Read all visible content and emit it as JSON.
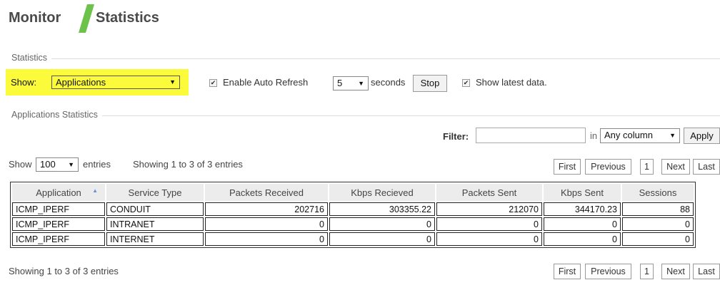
{
  "header": {
    "section": "Monitor",
    "page": "Statistics",
    "slash_color": "#6cc24a"
  },
  "stats_panel": {
    "legend": "Statistics",
    "show_label": "Show:",
    "show_value": "Applications",
    "auto_refresh_label": "Enable Auto Refresh",
    "auto_refresh_checked": true,
    "interval_value": "5",
    "seconds_label": "seconds",
    "stop_label": "Stop",
    "latest_label": "Show latest data.",
    "latest_checked": true
  },
  "app_panel": {
    "legend": "Applications Statistics",
    "filter_label": "Filter:",
    "filter_value": "",
    "in_label": "in",
    "column_value": "Any column",
    "apply_label": "Apply",
    "show_label": "Show",
    "entries_value": "100",
    "entries_label": "entries",
    "info_top": "Showing 1 to 3 of 3 entries",
    "info_bottom": "Showing 1 to 3 of 3 entries",
    "pagination": {
      "first": "First",
      "previous": "Previous",
      "page": "1",
      "next": "Next",
      "last": "Last"
    }
  },
  "table": {
    "columns": [
      "Application",
      "Service Type",
      "Packets Received",
      "Kbps Recieved",
      "Packets Sent",
      "Kbps Sent",
      "Sessions"
    ],
    "rows": [
      [
        "ICMP_IPERF",
        "CONDUIT",
        "202716",
        "303355.22",
        "212070",
        "344170.23",
        "88"
      ],
      [
        "ICMP_IPERF",
        "INTRANET",
        "0",
        "0",
        "0",
        "0",
        "0"
      ],
      [
        "ICMP_IPERF",
        "INTERNET",
        "0",
        "0",
        "0",
        "0",
        "0"
      ]
    ]
  }
}
